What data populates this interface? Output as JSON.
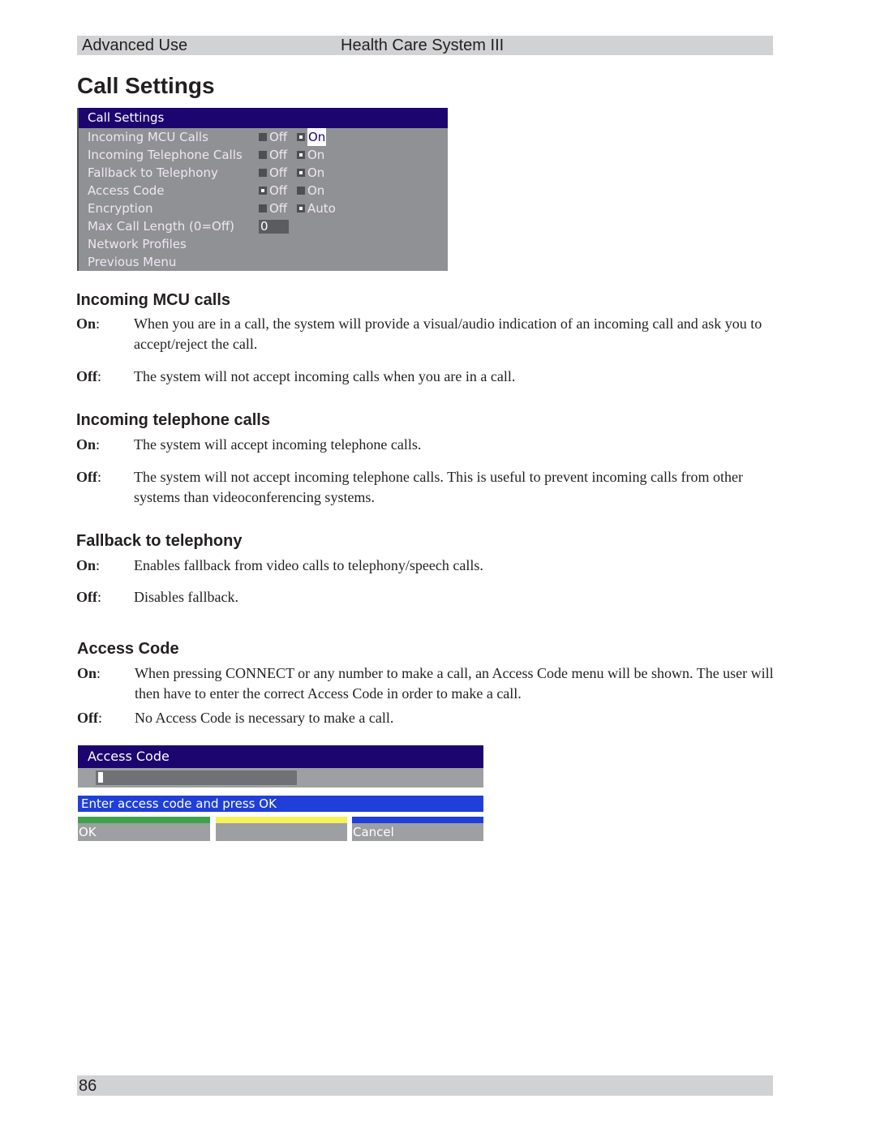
{
  "header": {
    "section": "Advanced Use",
    "product": "Health Care System III"
  },
  "page_title": "Call Settings",
  "osd_menu": {
    "title": "Call Settings",
    "rows": [
      {
        "label": "Incoming MCU Calls",
        "off": "Off",
        "on": "On",
        "selected": "On",
        "focused": "On"
      },
      {
        "label": "Incoming Telephone Calls",
        "off": "Off",
        "on": "On",
        "selected": "On"
      },
      {
        "label": "Fallback to Telephony",
        "off": "Off",
        "on": "On",
        "selected": "On"
      },
      {
        "label": "Access Code",
        "off": "Off",
        "on": "On",
        "selected": "Off"
      },
      {
        "label": "Encryption",
        "off": "Off",
        "on": "Auto",
        "selected": "Auto"
      },
      {
        "label": "Max Call Length (0=Off)",
        "value": "0"
      },
      {
        "label": "Network Profiles"
      },
      {
        "label": "Previous Menu"
      }
    ]
  },
  "sections": [
    {
      "heading": "Incoming MCU calls",
      "items": [
        {
          "term": "On",
          "text": "When you are in a call, the system will provide a visual/audio indication of an incoming call and ask you to accept/reject the call."
        },
        {
          "term": "Off",
          "text": "The system will not accept incoming calls when you are in a call."
        }
      ]
    },
    {
      "heading": "Incoming telephone calls",
      "items": [
        {
          "term": "On",
          "text": "The system will accept incoming telephone calls."
        },
        {
          "term": "Off",
          "text": "The system will not accept incoming telephone calls. This is useful to prevent incoming calls from other systems than videoconferencing systems."
        }
      ]
    },
    {
      "heading": "Fallback to telephony",
      "items": [
        {
          "term": "On",
          "text": "Enables fallback from video calls to telephony/speech calls."
        },
        {
          "term": "Off",
          "text": "Disables fallback."
        }
      ]
    },
    {
      "heading": "Access Code",
      "items": [
        {
          "term": "On",
          "text": "When pressing CONNECT or any number to make a call, an Access Code menu will be shown. The user will then have to enter the correct Access Code in order to make a call."
        },
        {
          "term": "Off",
          "text": "No Access Code is necessary to make a call."
        }
      ]
    }
  ],
  "term_separator": ":",
  "access_code_dialog": {
    "title": "Access Code",
    "input_value": "",
    "prompt": "Enter access code and press OK",
    "buttons": [
      {
        "label": "OK",
        "color": "#3fa34d"
      },
      {
        "label": "",
        "color": "#f5f25a"
      },
      {
        "label": "Cancel",
        "color": "#1f3fd8"
      }
    ]
  },
  "footer": {
    "page_number": "86"
  }
}
